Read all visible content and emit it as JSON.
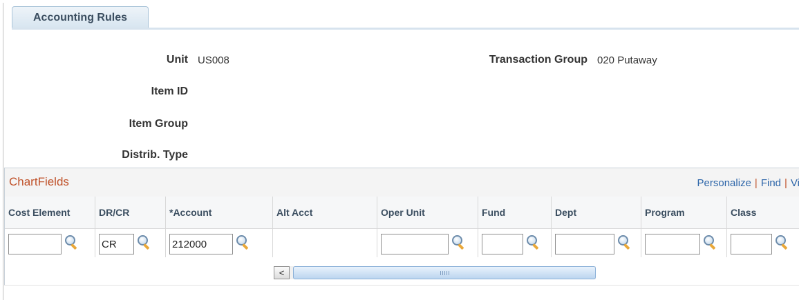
{
  "tab": {
    "label": "Accounting Rules"
  },
  "fields": {
    "unit_label": "Unit",
    "unit_value": "US008",
    "transaction_group_label": "Transaction Group",
    "transaction_group_value": "020 Putaway",
    "item_id_label": "Item ID",
    "item_group_label": "Item Group",
    "distrib_type_label": "Distrib. Type"
  },
  "grid": {
    "title": "ChartFields",
    "links": {
      "personalize": "Personalize",
      "find": "Find",
      "view": "Vi"
    },
    "columns": [
      {
        "header": "Cost Element",
        "value": "",
        "has_input": true
      },
      {
        "header": "DR/CR",
        "value": "CR",
        "has_input": true
      },
      {
        "header": "*Account",
        "value": "212000",
        "has_input": true
      },
      {
        "header": "Alt Acct",
        "value": "",
        "has_input": false
      },
      {
        "header": "Oper Unit",
        "value": "",
        "has_input": true
      },
      {
        "header": "Fund",
        "value": "",
        "has_input": true
      },
      {
        "header": "Dept",
        "value": "",
        "has_input": true
      },
      {
        "header": "Program",
        "value": "",
        "has_input": true
      },
      {
        "header": "Class",
        "value": "",
        "has_input": true
      }
    ],
    "scroll_left": "<"
  },
  "icons": {
    "lookup": "magnifier-icon"
  }
}
